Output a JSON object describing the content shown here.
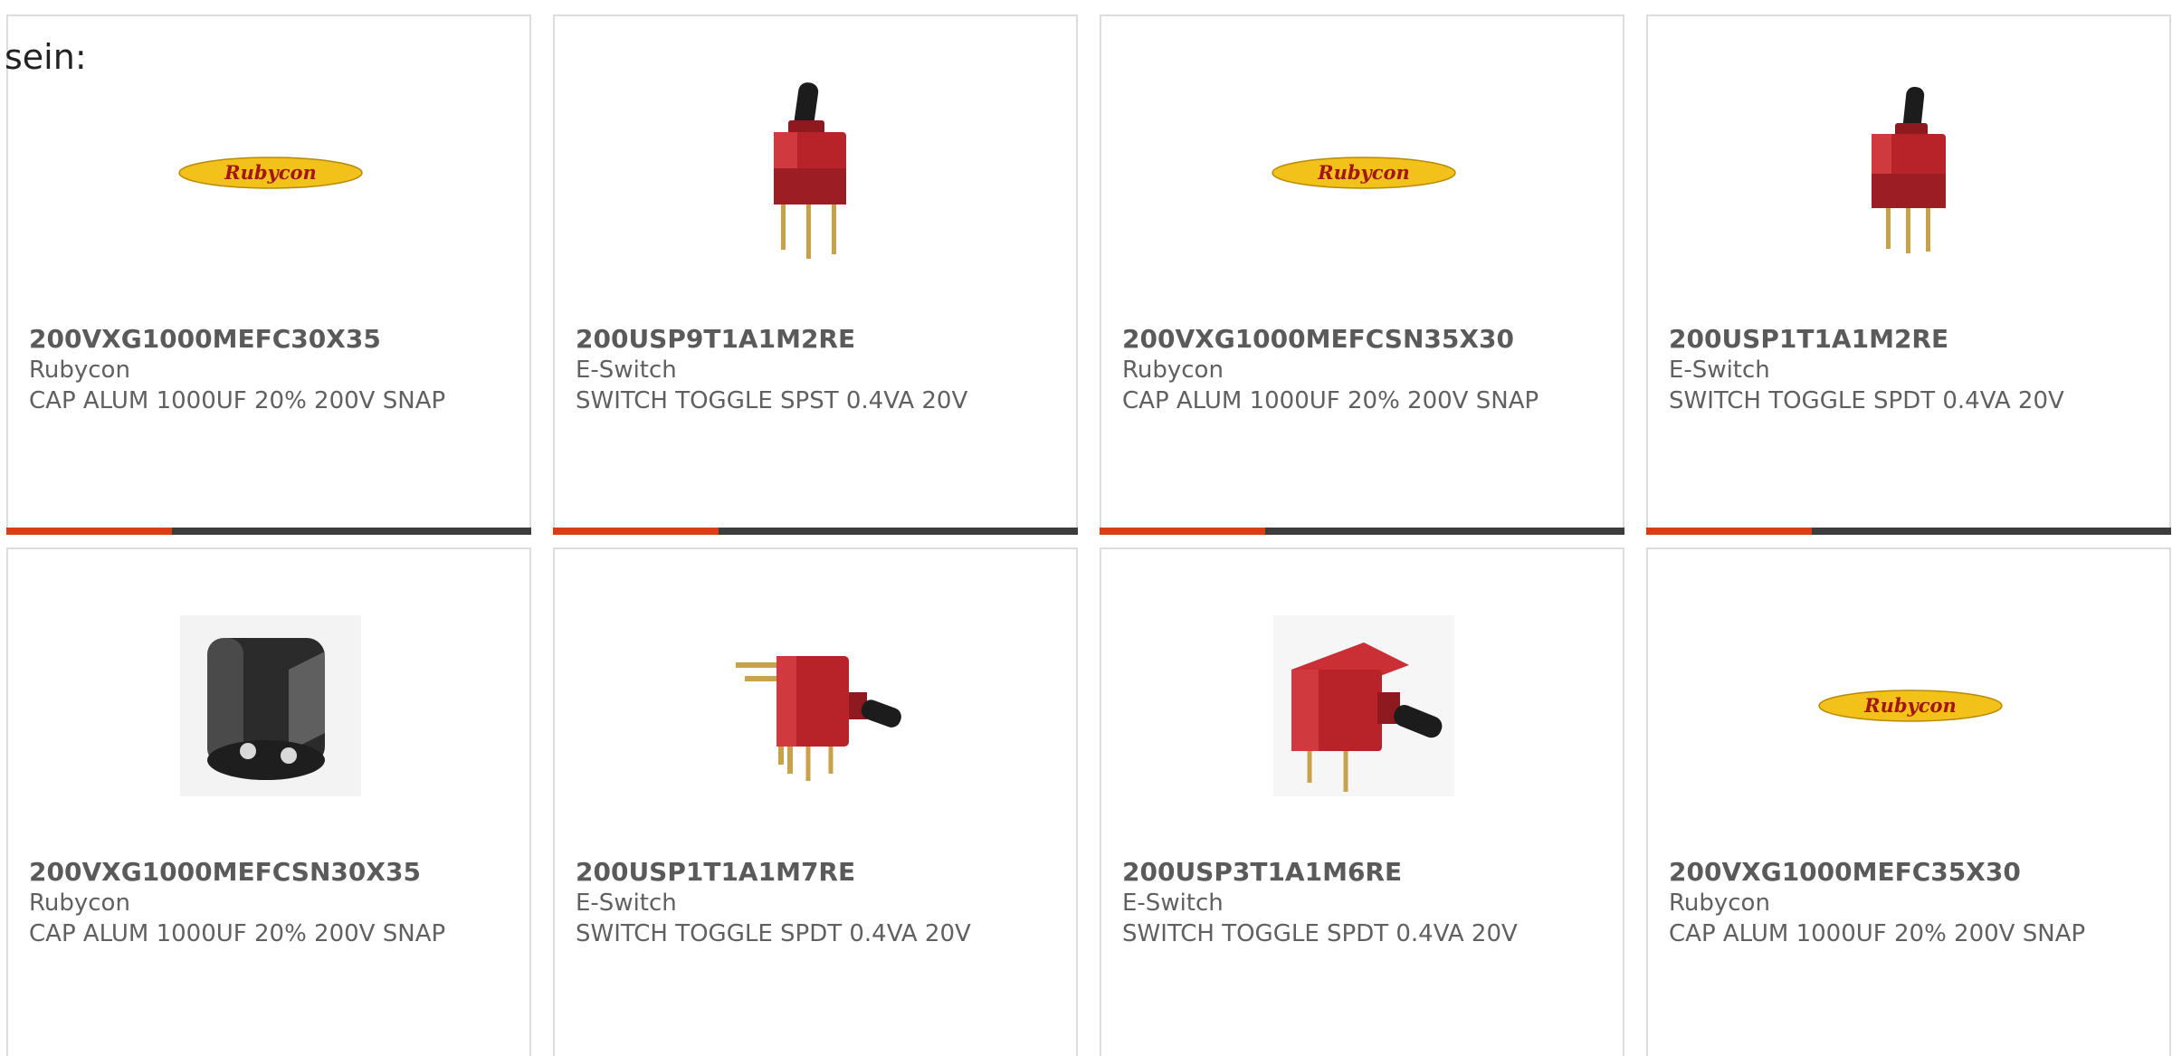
{
  "intro_text": "sein:",
  "products": [
    {
      "part": "200VXG1000MEFC30X35",
      "manufacturer": "Rubycon",
      "description": "CAP ALUM 1000UF 20% 200V SNAP",
      "image": "rubycon-logo-icon"
    },
    {
      "part": "200USP9T1A1M2RE",
      "manufacturer": "E-Switch",
      "description": "SWITCH TOGGLE SPST 0.4VA 20V",
      "image": "toggle-switch-vertical-icon"
    },
    {
      "part": "200VXG1000MEFCSN35X30",
      "manufacturer": "Rubycon",
      "description": "CAP ALUM 1000UF 20% 200V SNAP",
      "image": "rubycon-logo-icon"
    },
    {
      "part": "200USP1T1A1M2RE",
      "manufacturer": "E-Switch",
      "description": "SWITCH TOGGLE SPDT 0.4VA 20V",
      "image": "toggle-switch-vertical-icon"
    },
    {
      "part": "200VXG1000MEFCSN30X35",
      "manufacturer": "Rubycon",
      "description": "CAP ALUM 1000UF 20% 200V SNAP",
      "image": "capacitor-snap-in-icon"
    },
    {
      "part": "200USP1T1A1M7RE",
      "manufacturer": "E-Switch",
      "description": "SWITCH TOGGLE SPDT 0.4VA 20V",
      "image": "toggle-switch-right-angle-icon"
    },
    {
      "part": "200USP3T1A1M6RE",
      "manufacturer": "E-Switch",
      "description": "SWITCH TOGGLE SPDT 0.4VA 20V",
      "image": "toggle-switch-right-angle-icon"
    },
    {
      "part": "200VXG1000MEFC35X30",
      "manufacturer": "Rubycon",
      "description": "CAP ALUM 1000UF 20% 200V SNAP",
      "image": "rubycon-logo-icon"
    }
  ],
  "logo_text": "Rubycon",
  "colors": {
    "accent_bar": "#dd3d12",
    "bar_dark": "#3d3d3d",
    "card_border": "#dddddd",
    "text_gray": "#606060",
    "logo_yellow": "#f2c21b",
    "switch_red": "#b8232a",
    "capacitor_dark": "#2b2b2b"
  }
}
